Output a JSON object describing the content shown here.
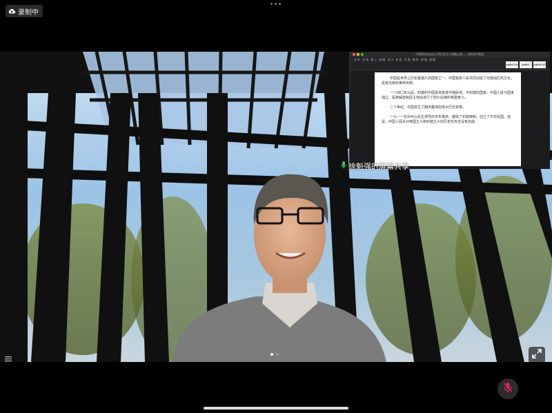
{
  "recording": {
    "label": "录制中",
    "icon": "cloud-record-icon"
  },
  "screen_share": {
    "label": "徐魁强的屏幕共享",
    "window_title": "中国如何走出自己的社会主义道路之路——研究读书报告",
    "ribbon_tabs": "文件 开始 插入 绘图 设计 布局 引用 邮件 审阅 视图",
    "style_buttons": [
      "AaBbCcDd",
      "AaBbC",
      "AaBbCcD"
    ],
    "document_paragraphs": [
      "中国是世界上历史最悠久的国家之一。中国各族人民共同创造了光辉灿烂的文化，具有光荣的革命传统。",
      "一八四〇年以后，封建的中国逐渐变成半殖民地、半封建的国家。中国人民为国家独立、民族解放和民主自由进行了前仆后继的英勇奋斗。",
      "二十世纪，中国发生了翻天覆地的伟大历史变革。",
      "一九一一年孙中山先生领导的辛亥革命，废除了封建帝制，创立了中华民国。但是，中国人民反对帝国主义和封建主义的历史任务还没有完成。"
    ]
  },
  "page_indicator": {
    "count": 2,
    "active": 0
  },
  "controls": {
    "mic_icon": "mic-muted-icon",
    "expand_icon": "expand-icon"
  },
  "colors": {
    "background": "#000000",
    "mic_muted": "#e0245e",
    "mic_indicator": "#34c759"
  }
}
